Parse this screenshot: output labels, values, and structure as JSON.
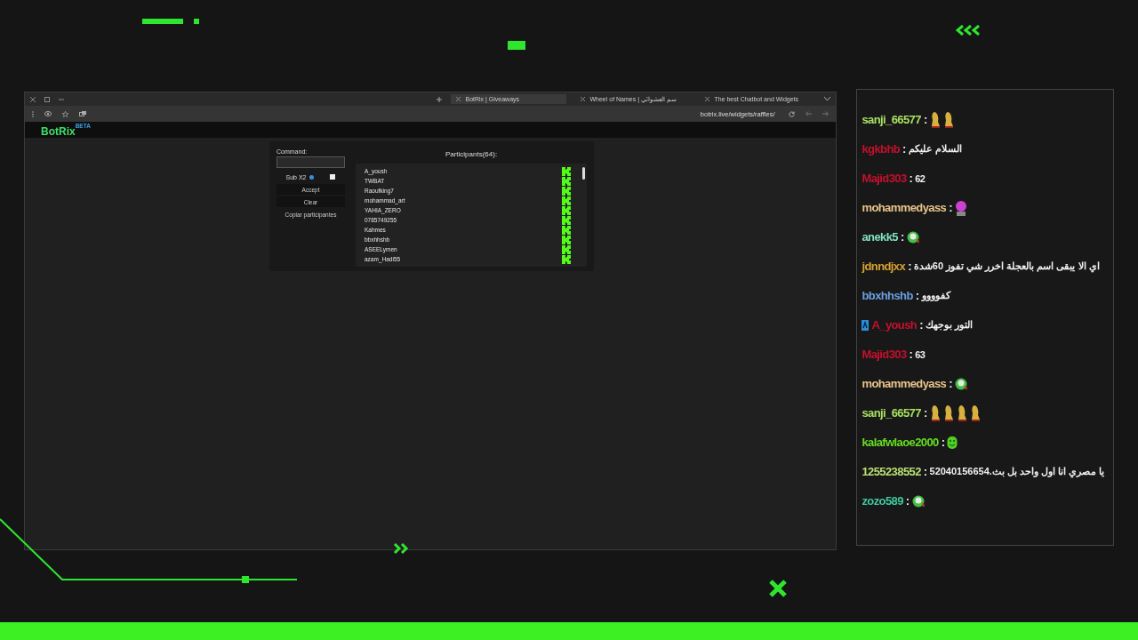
{
  "browser": {
    "tabs": [
      {
        "label": "BotRix | Giveaways",
        "selected": true
      },
      {
        "label": "Wheel of Names | سم العشوائي",
        "selected": false
      },
      {
        "label": "The best Chatbot and Widgets",
        "selected": false
      }
    ],
    "url": "botrix.live/widgets/raffles/"
  },
  "site": {
    "logo": "BotRix",
    "logo_badge": "BETA"
  },
  "raffle": {
    "command_label": "Command:",
    "sub_option": {
      "label": "Sub X2",
      "checked": false
    },
    "buttons": [
      "Accept",
      "Clear",
      "Copiar participantes"
    ],
    "participants_title": "Participants(64):",
    "participants": [
      "A_yoush",
      "TWBAT",
      "Raoufking7",
      "mohammad_art",
      "YAHIA_ZERO",
      "0785749255",
      "Kahmes",
      "bbxhhshb",
      "ASEELymen",
      "azam_Hadi55"
    ]
  },
  "chat": [
    {
      "user": "sanji_66577",
      "color": "#a8e060",
      "badge": false,
      "separator": ":",
      "emotes": [
        {
          "kind": "figure"
        },
        {
          "kind": "figure"
        }
      ]
    },
    {
      "user": "kgkbhb",
      "color": "#c4102e",
      "badge": false,
      "separator": ":",
      "text": "السلام عليكم"
    },
    {
      "user": "Majid303",
      "color": "#c4102e",
      "badge": false,
      "separator": ":",
      "text": "62"
    },
    {
      "user": "mohammedyass",
      "color": "#e8c48a",
      "badge": false,
      "separator": ":",
      "emotes": [
        {
          "kind": "pink-face"
        }
      ]
    },
    {
      "user": "anekk5",
      "color": "#80e0c0",
      "badge": false,
      "separator": ":",
      "emotes": [
        {
          "kind": "green-face"
        }
      ]
    },
    {
      "user": "jdnndjxx",
      "color": "#d8a030",
      "badge": false,
      "separator": ":",
      "text": "اي الا يبقى اسم بالعجلة اخرر شي تفوز 60شدة"
    },
    {
      "user": "bbxhhshb",
      "color": "#6a9fe0",
      "badge": false,
      "separator": ":",
      "text": "كفوووو"
    },
    {
      "user": "A_yoush",
      "color": "#c4102e",
      "badge": true,
      "separator": ":",
      "text": "التور بوجهك"
    },
    {
      "user": "Majid303",
      "color": "#c4102e",
      "badge": false,
      "separator": ":",
      "text": "63"
    },
    {
      "user": "mohammedyass",
      "color": "#e8c48a",
      "badge": false,
      "separator": ":",
      "emotes": [
        {
          "kind": "green-face"
        }
      ]
    },
    {
      "user": "sanji_66577",
      "color": "#a8e060",
      "badge": false,
      "separator": ":",
      "emotes": [
        {
          "kind": "figure"
        },
        {
          "kind": "figure"
        },
        {
          "kind": "figure"
        },
        {
          "kind": "figure"
        }
      ]
    },
    {
      "user": "kalafwlaoe2000",
      "color": "#66dd22",
      "badge": false,
      "separator": ":",
      "emotes": [
        {
          "kind": "smiley"
        }
      ]
    },
    {
      "user": "1255238552",
      "color": "#b8e070",
      "badge": false,
      "separator": ":",
      "text": "يا مصري انا اول واحد بل بث.52040156654"
    },
    {
      "user": "zozo589",
      "color": "#40c8a0",
      "badge": false,
      "separator": ":",
      "emotes": [
        {
          "kind": "green-face"
        }
      ]
    }
  ]
}
